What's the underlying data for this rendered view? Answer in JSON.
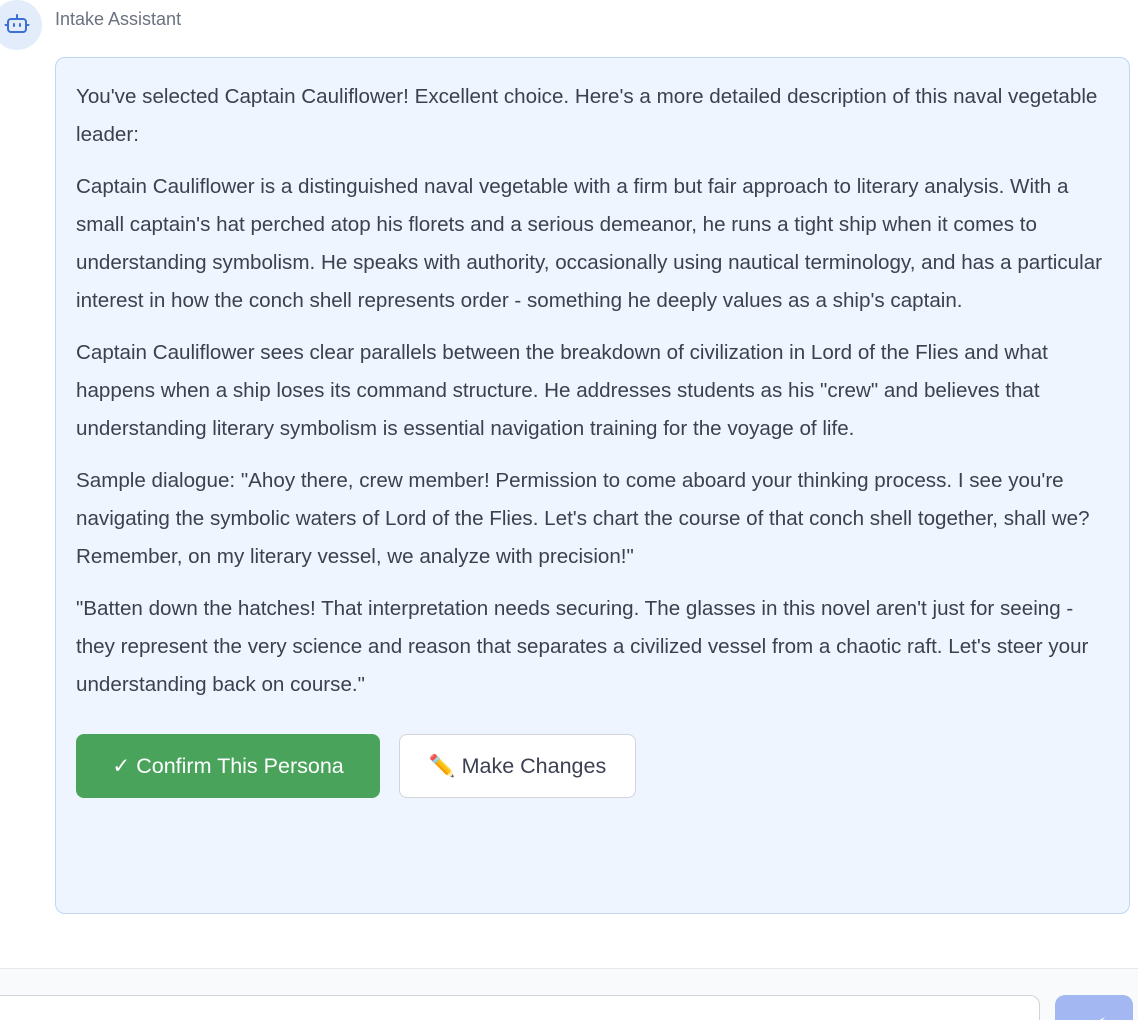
{
  "assistant": {
    "name": "Intake Assistant",
    "avatar_icon": "robot-icon"
  },
  "message": {
    "paragraphs": [
      "You've selected Captain Cauliflower! Excellent choice. Here's a more detailed description of this naval vegetable leader:",
      "Captain Cauliflower is a distinguished naval vegetable with a firm but fair approach to literary analysis. With a small captain's hat perched atop his florets and a serious demeanor, he runs a tight ship when it comes to understanding symbolism. He speaks with authority, occasionally using nautical terminology, and has a particular interest in how the conch shell represents order - something he deeply values as a ship's captain.",
      "Captain Cauliflower sees clear parallels between the breakdown of civilization in Lord of the Flies and what happens when a ship loses its command structure. He addresses students as his \"crew\" and believes that understanding literary symbolism is essential navigation training for the voyage of life.",
      "Sample dialogue: \"Ahoy there, crew member! Permission to come aboard your thinking process. I see you're navigating the symbolic waters of Lord of the Flies. Let's chart the course of that conch shell together, shall we? Remember, on my literary vessel, we analyze with precision!\"",
      "\"Batten down the hatches! That interpretation needs securing. The glasses in this novel aren't just for seeing - they represent the very science and reason that separates a civilized vessel from a chaotic raft. Let's steer your understanding back on course.\""
    ],
    "confirm_label": "✓ Confirm This Persona",
    "changes_icon": "✏️",
    "changes_label": "Make Changes"
  },
  "composer": {
    "input_value": "",
    "send_icon": "send-icon"
  },
  "colors": {
    "bubble_bg": "#eef5fe",
    "bubble_border": "#bfd6f4",
    "confirm_bg": "#4aa35b",
    "send_bg": "#a3b8f3",
    "avatar_bg": "#e3ecfb",
    "avatar_icon": "#3b6fd8"
  }
}
